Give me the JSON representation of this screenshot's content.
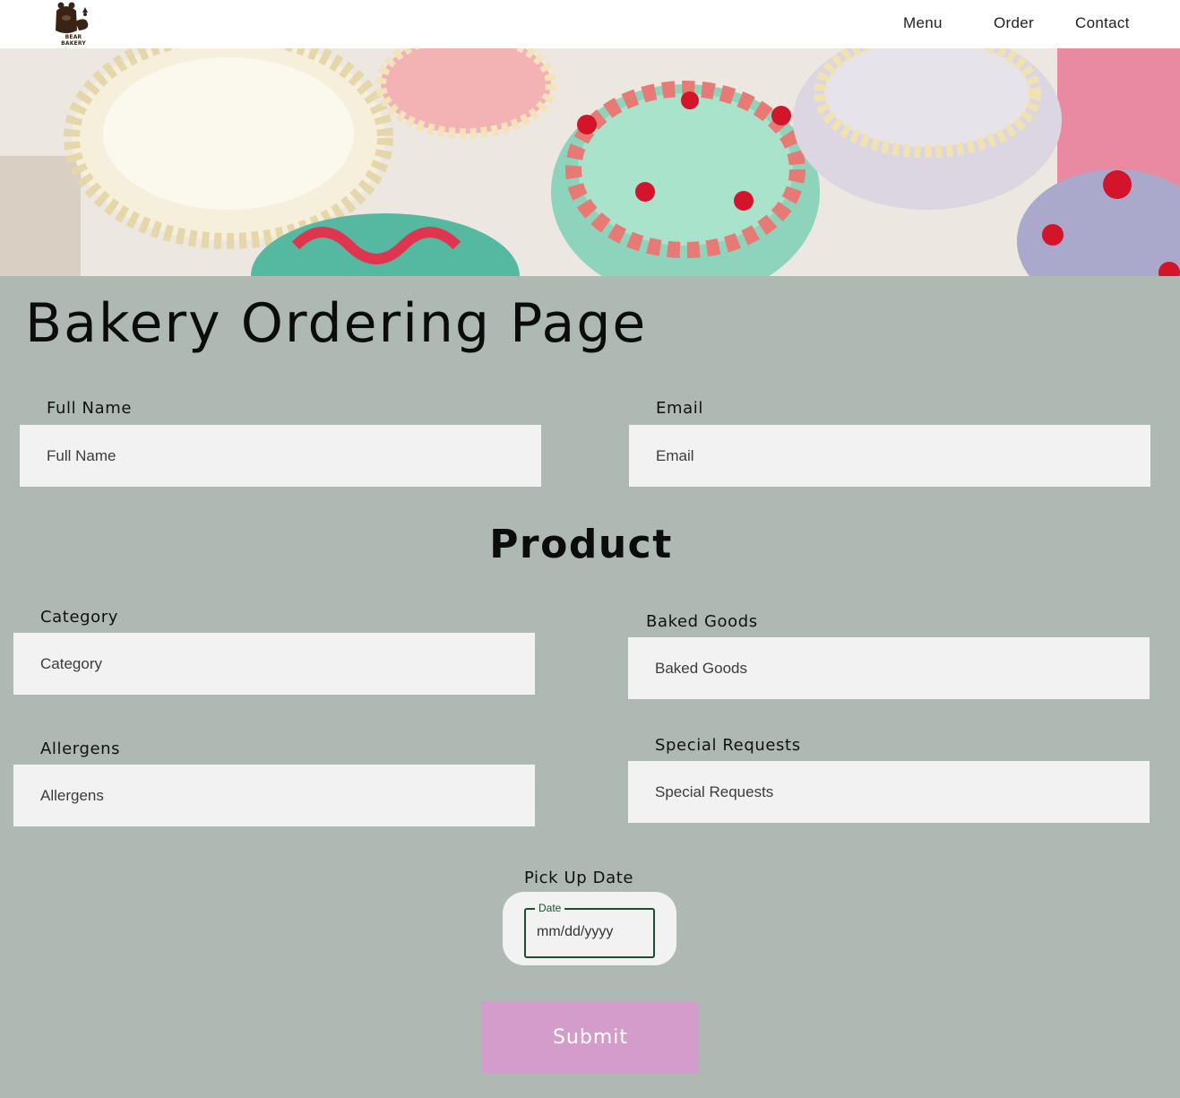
{
  "header": {
    "logo_text": "BEAR BAKERY",
    "nav": [
      "Menu",
      "Order",
      "Contact"
    ]
  },
  "hero": {
    "icon": "cakes-banner-image"
  },
  "page_title": "Bakery Ordering Page",
  "contact": {
    "full_name": {
      "label": "Full Name",
      "placeholder": "Full Name"
    },
    "email": {
      "label": "Email",
      "placeholder": "Email"
    }
  },
  "product": {
    "title": "Product",
    "category": {
      "label": "Category",
      "placeholder": "Category"
    },
    "baked_goods": {
      "label": "Baked Goods",
      "placeholder": "Baked Goods"
    },
    "allergens": {
      "label": "Allergens",
      "placeholder": "Allergens"
    },
    "special_requests": {
      "label": "Special Requests",
      "placeholder": "Special Requests"
    }
  },
  "pickup": {
    "label": "Pick Up Date",
    "legend": "Date",
    "placeholder": "mm/dd/yyyy"
  },
  "submit_label": "Submit",
  "colors": {
    "background": "#afb9b4",
    "field": "#f2f2f2",
    "submit": "#d49ccb",
    "date_border": "#1d4d2c"
  }
}
